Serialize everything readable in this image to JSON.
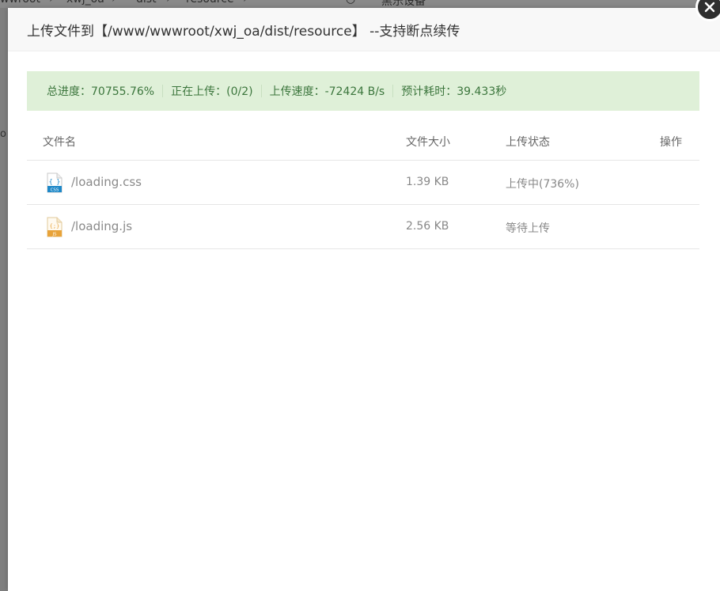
{
  "background": {
    "breadcrumb": [
      "wwroot",
      "xwj_oa",
      "dist",
      "resource"
    ],
    "side_text": "o",
    "right_text": "黑乐设备"
  },
  "dialog": {
    "title": "上传文件到【/www/wwwroot/xwj_oa/dist/resource】 --支持断点续传",
    "progress": {
      "total": "总进度：70755.76%",
      "uploading": "正在上传：(0/2)",
      "speed": "上传速度：-72424 B/s",
      "eta": "预计耗时：39.433秒"
    },
    "table": {
      "headers": {
        "name": "文件名",
        "size": "文件大小",
        "status": "上传状态",
        "action": "操作"
      },
      "rows": [
        {
          "name": "/loading.css",
          "size": "1.39 KB",
          "status": "上传中(736%)",
          "icon": "css-file-icon",
          "icon_label": "CSS"
        },
        {
          "name": "/loading.js",
          "size": "2.56 KB",
          "status": "等待上传",
          "icon": "js-file-icon",
          "icon_label": "JS"
        }
      ]
    }
  },
  "colors": {
    "progress_bg": "#dff0d8",
    "progress_text": "#3c763d",
    "css_icon": "#1e88c8",
    "js_icon": "#e8a33a"
  }
}
